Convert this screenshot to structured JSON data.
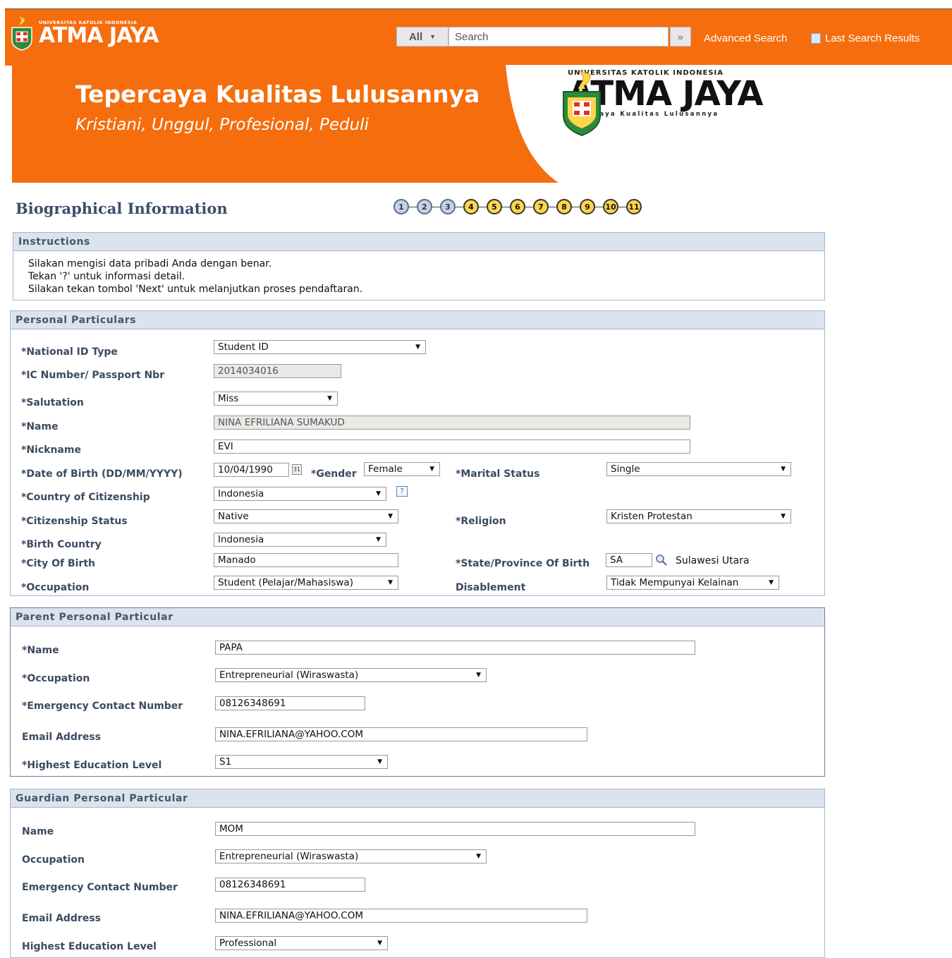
{
  "header": {
    "logo_small_univ": "UNIVERSITAS KATOLIK INDONESIA",
    "logo_small_name": "ATMA JAYA",
    "search_scope": "All",
    "search_placeholder": "Search",
    "advanced_search": "Advanced Search",
    "last_search_results": "Last Search Results"
  },
  "banner": {
    "headline": "Tepercaya Kualitas Lulusannya",
    "tagline": "Kristiani, Unggul, Profesional, Peduli",
    "logo_univ": "UNIVERSITAS KATOLIK INDONESIA",
    "logo_name": "ATMA JAYA",
    "logo_slogan": "Tepercaya Kualitas Lulusannya"
  },
  "page": {
    "title": "Biographical Information",
    "steps": [
      "1",
      "2",
      "3",
      "4",
      "5",
      "6",
      "7",
      "8",
      "9",
      "10",
      "11"
    ],
    "completed_steps": 3
  },
  "instructions": {
    "title": "Instructions",
    "line1": "Silakan mengisi data pribadi Anda dengan benar.",
    "line2": "Tekan '?' untuk informasi detail.",
    "line3": "Silakan tekan tombol 'Next' untuk melanjutkan proses pendaftaran."
  },
  "personal": {
    "title": "Personal Particulars",
    "national_id_type_label": "*National ID Type",
    "national_id_type": "Student ID",
    "ic_number_label": "*IC Number/ Passport Nbr",
    "ic_number": "2014034016",
    "salutation_label": "*Salutation",
    "salutation": "Miss",
    "name_label": "*Name",
    "name": "NINA EFRILIANA SUMAKUD",
    "nickname_label": "*Nickname",
    "nickname": "EVI",
    "dob_label": "*Date of Birth (DD/MM/YYYY)",
    "dob": "10/04/1990",
    "gender_label": "*Gender",
    "gender": "Female",
    "marital_label": "*Marital Status",
    "marital": "Single",
    "citizenship_country_label": "*Country of Citizenship",
    "citizenship_country": "Indonesia",
    "citizenship_status_label": "*Citizenship Status",
    "citizenship_status": "Native",
    "religion_label": "*Religion",
    "religion": "Kristen Protestan",
    "birth_country_label": "*Birth Country",
    "birth_country": "Indonesia",
    "city_label": "*City Of Birth",
    "city": "Manado",
    "state_label": "*State/Province Of Birth",
    "state_code": "SA",
    "state_name": "Sulawesi Utara",
    "occupation_label": "*Occupation",
    "occupation": "Student (Pelajar/Mahasiswa)",
    "disablement_label": "Disablement",
    "disablement": "Tidak Mempunyai Kelainan"
  },
  "parent": {
    "title": "Parent Personal Particular",
    "name_label": "*Name",
    "name": "PAPA",
    "occupation_label": "*Occupation",
    "occupation": "Entrepreneurial (Wiraswasta)",
    "phone_label": "*Emergency Contact Number",
    "phone": "08126348691",
    "email_label": "Email Address",
    "email": "NINA.EFRILIANA@YAHOO.COM",
    "education_label": "*Highest Education Level",
    "education": "S1"
  },
  "guardian": {
    "title": "Guardian Personal Particular",
    "name_label": "Name",
    "name": "MOM",
    "occupation_label": "Occupation",
    "occupation": "Entrepreneurial (Wiraswasta)",
    "phone_label": "Emergency Contact Number",
    "phone": "08126348691",
    "email_label": "Email Address",
    "email": "NINA.EFRILIANA@YAHOO.COM",
    "education_label": "Highest Education Level",
    "education": "Professional"
  },
  "colors": {
    "brand_orange": "#f56d0c",
    "section_header": "#dbe3ee",
    "label_text": "#3b4b61",
    "step_active": "#ffd54a",
    "step_done": "#c5d2e3"
  },
  "icons": [
    "calendar-icon",
    "help-icon",
    "lookup-search-icon",
    "dropdown-arrow-icon",
    "search-go-icon",
    "last-results-icon"
  ]
}
